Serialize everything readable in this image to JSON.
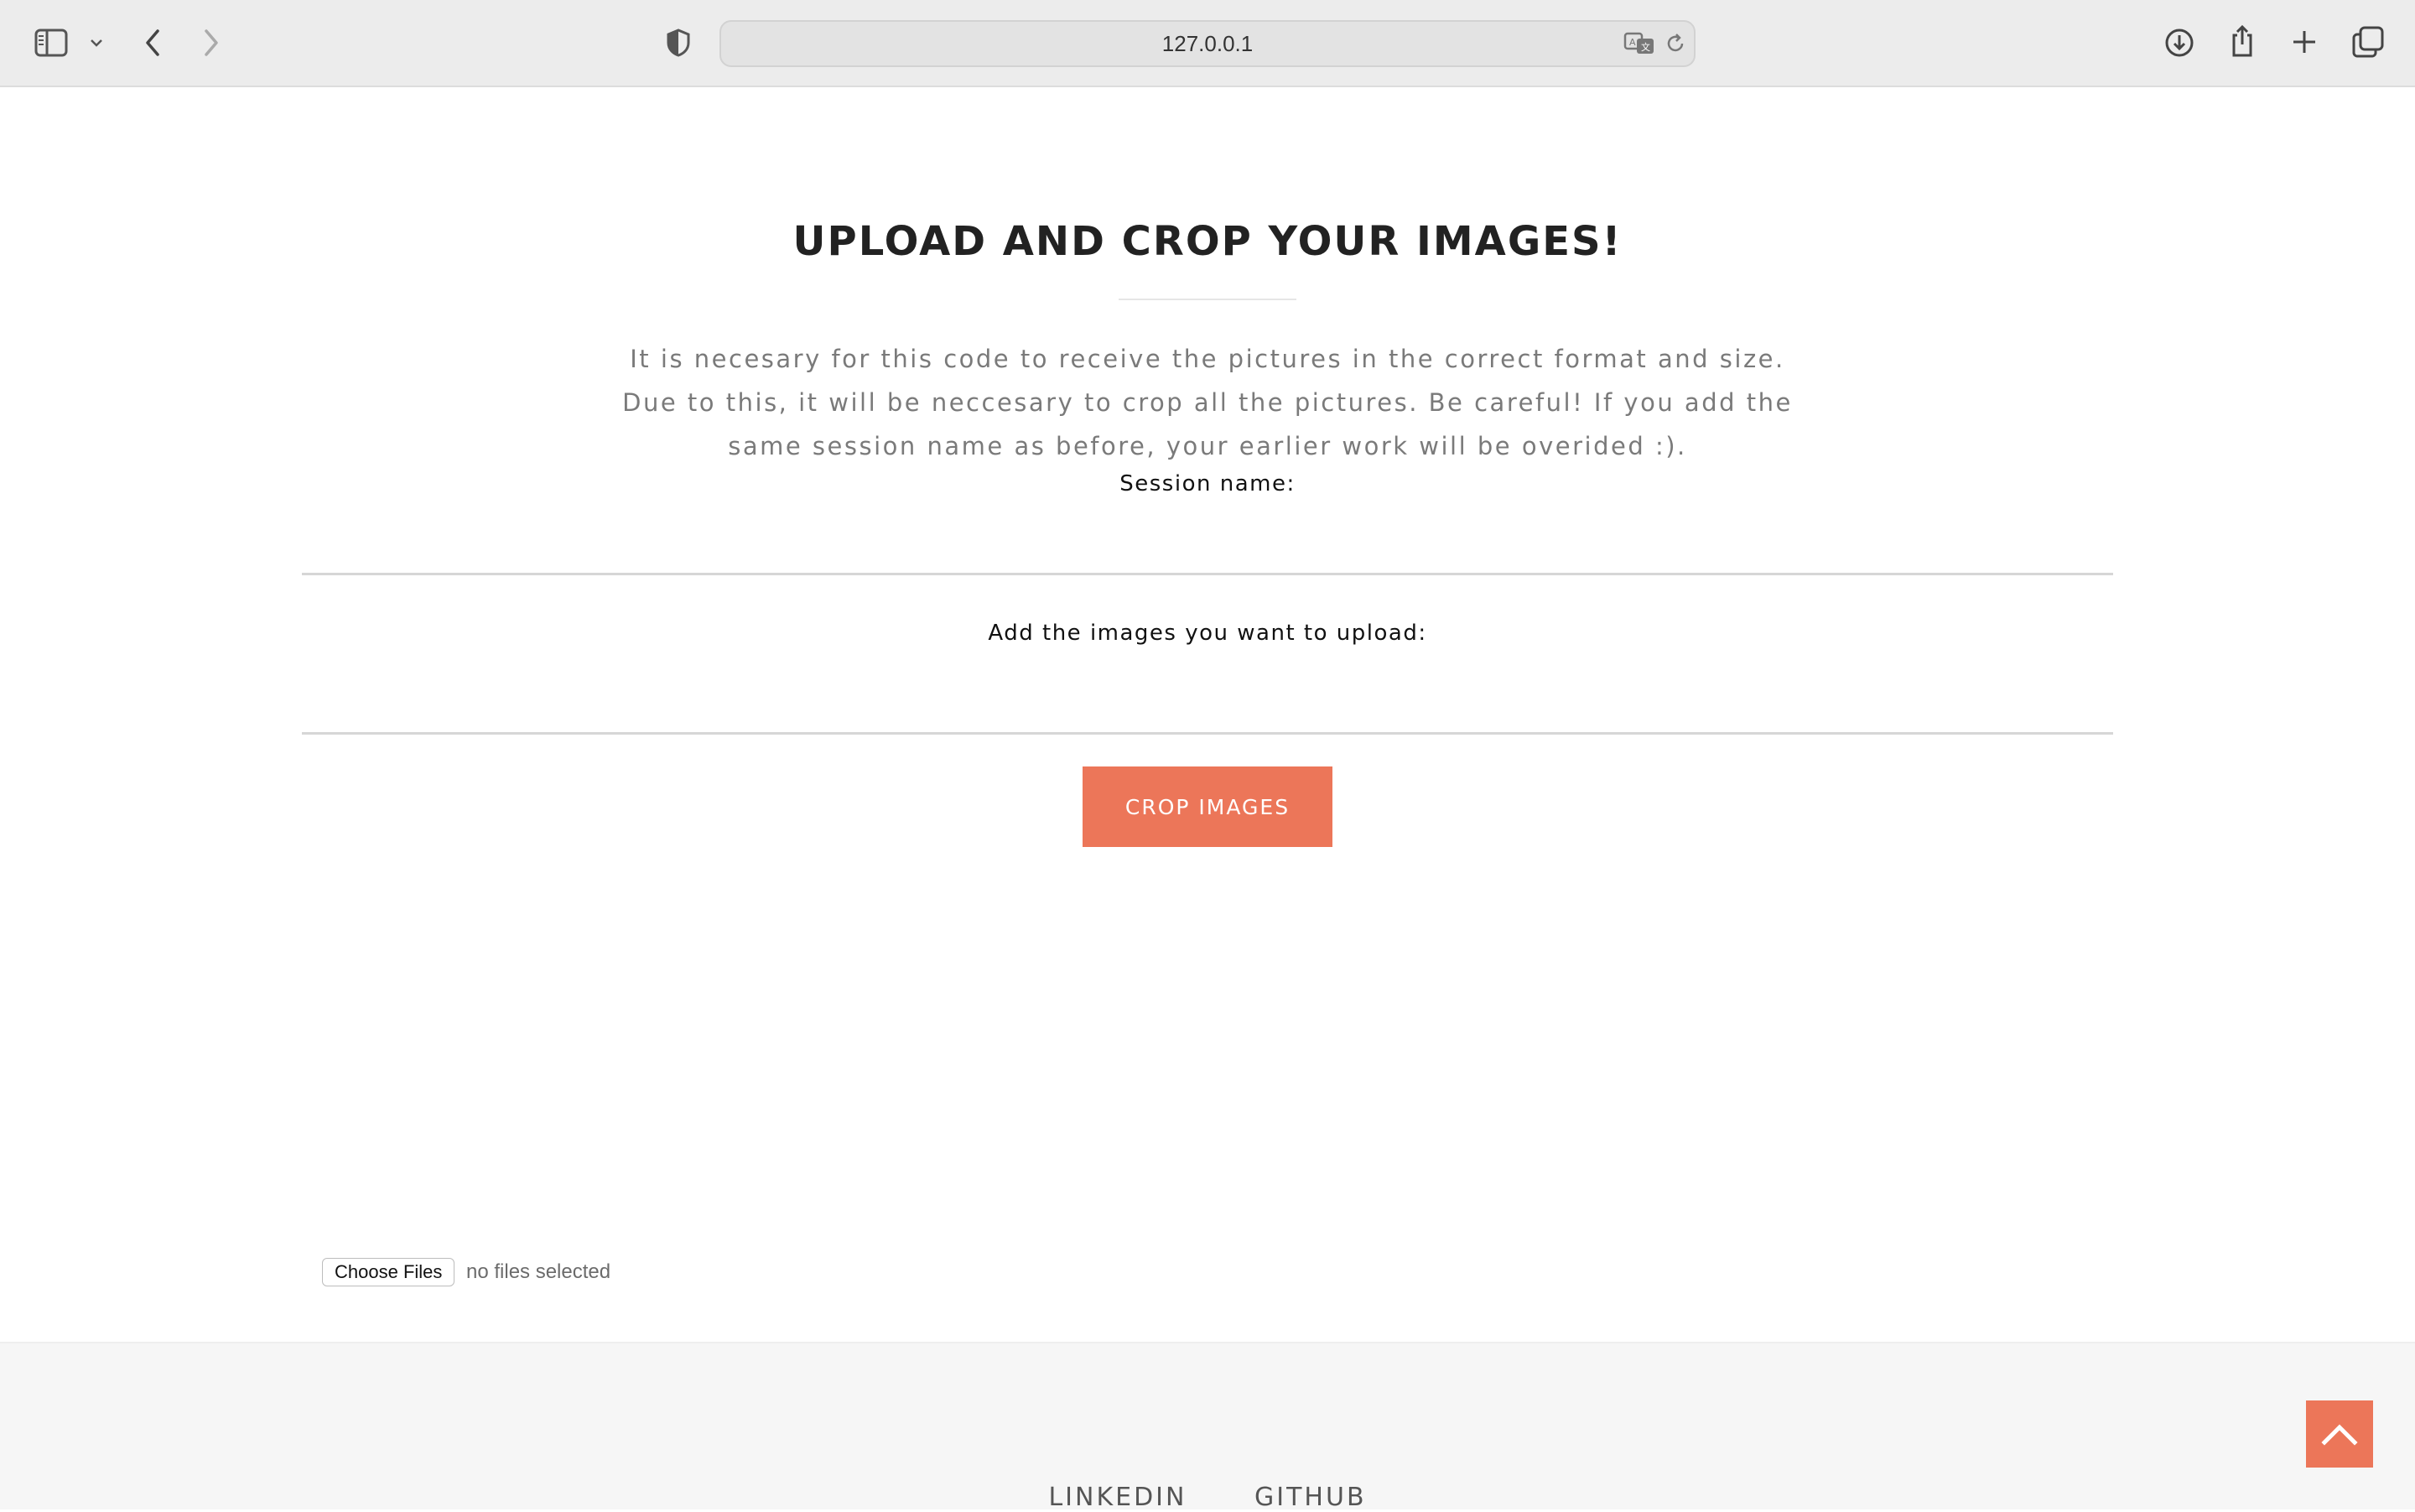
{
  "browser": {
    "url": "127.0.0.1",
    "icons": [
      "sidebar-icon",
      "chevron-down-icon",
      "back-icon",
      "forward-icon",
      "shield-icon",
      "translate-icon",
      "reload-icon",
      "download-icon",
      "share-icon",
      "new-tab-icon",
      "tabs-overview-icon"
    ]
  },
  "main": {
    "title": "UPLOAD AND CROP YOUR IMAGES!",
    "description_lines": [
      "It is necesary for this code to receive the pictures in the correct format and size.",
      "Due to this, it will be neccesary to crop all the pictures. Be careful! If you add the",
      "same session name as before, your earlier work will be overided :)."
    ],
    "session_label": "Session name:",
    "session_value": "",
    "images_label": "Add the images you want to upload:",
    "choose_files_label": "Choose Files",
    "file_status": "no files selected",
    "crop_button_label": "CROP IMAGES"
  },
  "footer": {
    "links": [
      "LINKEDIN",
      "GITHUB"
    ],
    "to_top_icon": "chevron-up-icon"
  },
  "colors": {
    "accent": "#ec7659",
    "toolbar_bg": "#ececec",
    "footer_bg": "#f6f6f6"
  }
}
